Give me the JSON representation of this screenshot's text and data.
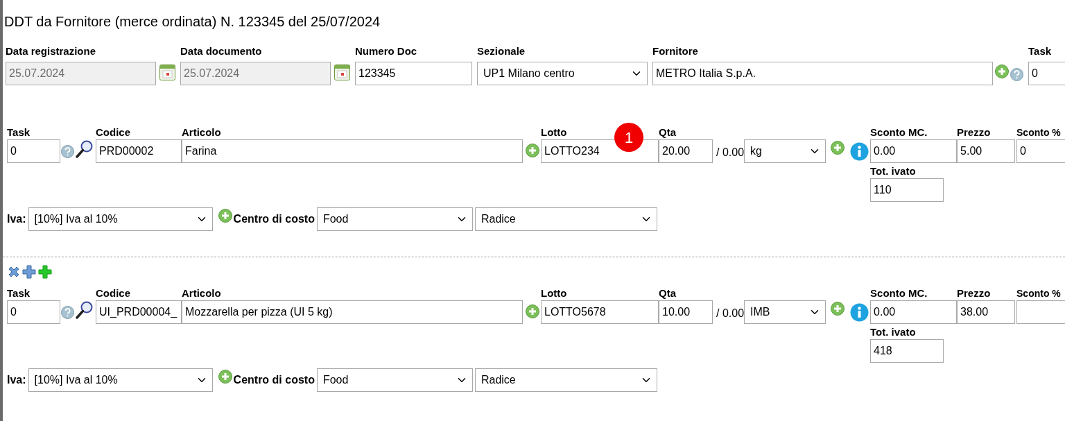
{
  "title": "DDT da Fornitore (merce ordinata) N. 123345 del 25/07/2024",
  "header": {
    "fields": [
      {
        "kind": "date",
        "label": "Data registrazione",
        "value": "25.07.2024",
        "disabled": true
      },
      {
        "kind": "date",
        "label": "Data documento",
        "value": "25.07.2024",
        "disabled": true
      },
      {
        "kind": "text",
        "label": "Numero Doc",
        "value": "123345",
        "disabled": false
      },
      {
        "kind": "select",
        "label": "Sezionale",
        "value": "UP1 Milano centro",
        "disabled": false
      },
      {
        "kind": "supplier",
        "label": "Fornitore",
        "value": "METRO Italia S.p.A.",
        "disabled": false
      },
      {
        "kind": "task",
        "label": "Task",
        "value": "0",
        "disabled": false
      }
    ]
  },
  "lines": [
    {
      "show_actions": false,
      "callout": "1",
      "labels": {
        "task": "Task",
        "codice": "Codice",
        "articolo": "Articolo",
        "lotto": "Lotto",
        "qta": "Qta",
        "sconto_mc": "Sconto MC.",
        "prezzo": "Prezzo",
        "sconto_pct": "Sconto %",
        "tot_ivato": "Tot. ivato",
        "iva": "Iva:",
        "centro_costo": "Centro di costo"
      },
      "task": "0",
      "codice": "PRD00002",
      "articolo": "Farina",
      "lotto": "LOTTO234",
      "qta": "20.00",
      "available": "/ 0.00",
      "unit": "kg",
      "sconto_mc": "0.00",
      "prezzo": "5.00",
      "sconto_pct": "0",
      "tot_ivato": "110",
      "iva": "[10%] Iva al 10%",
      "centro_costo": "Food",
      "centro_parent": "Radice"
    },
    {
      "show_actions": true,
      "labels": {
        "task": "Task",
        "codice": "Codice",
        "articolo": "Articolo",
        "lotto": "Lotto",
        "qta": "Qta",
        "sconto_mc": "Sconto MC.",
        "prezzo": "Prezzo",
        "sconto_pct": "Sconto %",
        "tot_ivato": "Tot. ivato",
        "iva": "Iva:",
        "centro_costo": "Centro di costo"
      },
      "task": "0",
      "codice": "UI_PRD00004_",
      "articolo": "Mozzarella per pizza (UI 5 kg)",
      "lotto": "LOTTO5678",
      "qta": "10.00",
      "available": "/ 0.00",
      "unit": "IMB",
      "sconto_mc": "0.00",
      "prezzo": "38.00",
      "tot_ivato": "418",
      "iva": "[10%] Iva al 10%",
      "centro_costo": "Food",
      "centro_parent": "Radice"
    }
  ]
}
